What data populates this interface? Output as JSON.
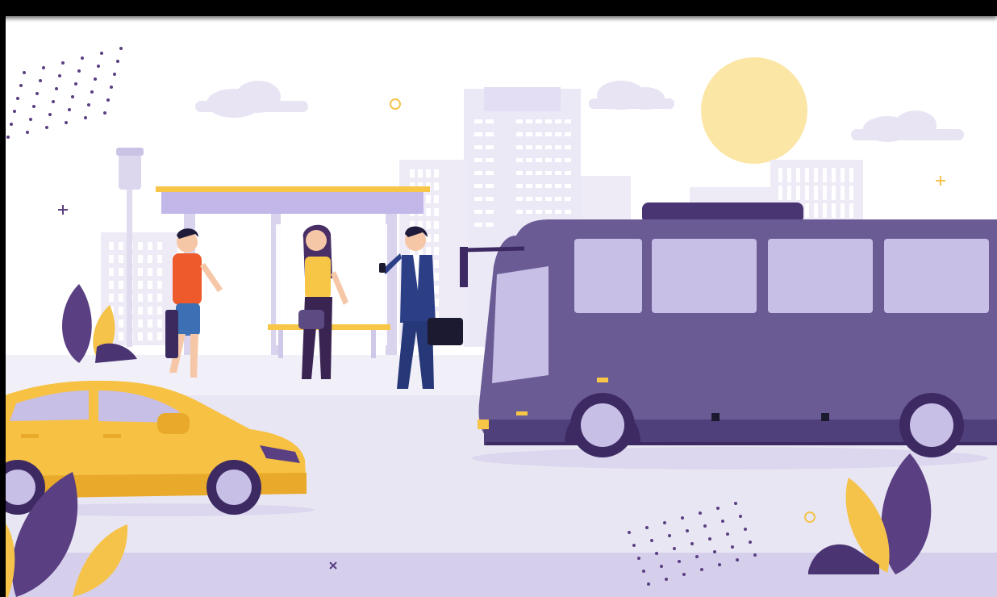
{
  "scene": {
    "subject": "bus-stop-illustration",
    "colors": {
      "bus_body": "#6b5b95",
      "bus_dark": "#3d2a63",
      "bus_window": "#c7bfe6",
      "taxi": "#f7c143",
      "taxi_dark": "#e9a92a",
      "sun": "#fbe6a6",
      "shelter_roof": "#c2b7e8",
      "shelter_trim": "#f7c646",
      "road": "#e7e4f1",
      "sidewalk": "#d8d2ec",
      "building": "#e9e5f5",
      "leaf_purple": "#5a3f82",
      "leaf_yellow": "#f5c34a"
    }
  }
}
